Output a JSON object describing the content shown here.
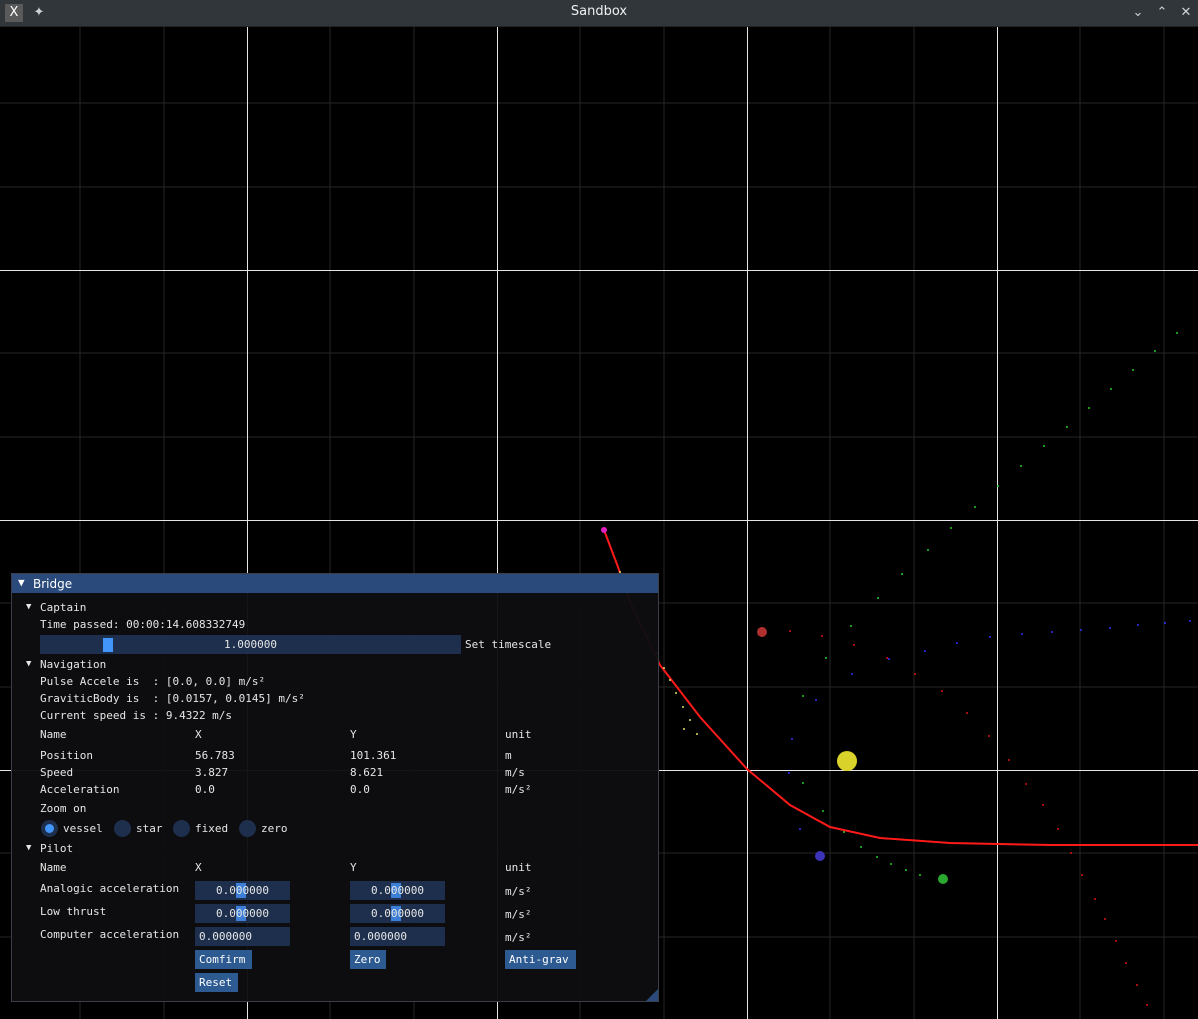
{
  "window": {
    "title": "Sandbox"
  },
  "panel": {
    "title": "Bridge",
    "captain": {
      "header": "Captain",
      "time_passed": "Time passed: 00:00:14.608332749",
      "timescale_value": "1.000000",
      "timescale_label": "Set timescale"
    },
    "navigation": {
      "header": "Navigation",
      "pulse": "Pulse Accele is  : [0.0, 0.0] m/s²",
      "gravitic": "GraviticBody is  : [0.0157, 0.0145] m/s²",
      "speed": "Current speed is : 9.4322 m/s",
      "columns": [
        "Name",
        "X",
        "Y",
        "unit"
      ],
      "rows": [
        [
          "Position",
          "56.783",
          "101.361",
          "m"
        ],
        [
          "Speed",
          "3.827",
          "8.621",
          "m/s"
        ],
        [
          "Acceleration",
          "0.0",
          "0.0",
          "m/s²"
        ]
      ],
      "zoom_label": "Zoom on",
      "zoom_options": [
        "vessel",
        "star",
        "fixed",
        "zero"
      ],
      "zoom_selected": "vessel"
    },
    "pilot": {
      "header": "Pilot",
      "columns": [
        "Name",
        "X",
        "Y",
        "unit"
      ],
      "rows": [
        {
          "name": "Analogic acceleration",
          "x": "0.000000",
          "y": "0.000000",
          "unit": "m/s²"
        },
        {
          "name": "Low thrust",
          "x": "0.000000",
          "y": "0.000000",
          "unit": "m/s²"
        },
        {
          "name": "Computer acceleration",
          "x": "0.000000",
          "y": "0.000000",
          "unit": "m/s²"
        }
      ],
      "buttons": {
        "confirm": "Comfirm",
        "zero": "Zero",
        "antigrav": "Anti-grav",
        "reset": "Reset"
      }
    }
  },
  "colors": {
    "panel_title_bg": "#294a7a",
    "widget_bg": "#1d2f4c",
    "accent": "#4296fa",
    "trajectory": "#ff0000",
    "star": "#d8d22a"
  },
  "icons": [
    "app-icon",
    "pin-icon",
    "minimize-icon",
    "maximize-icon",
    "close-icon"
  ]
}
